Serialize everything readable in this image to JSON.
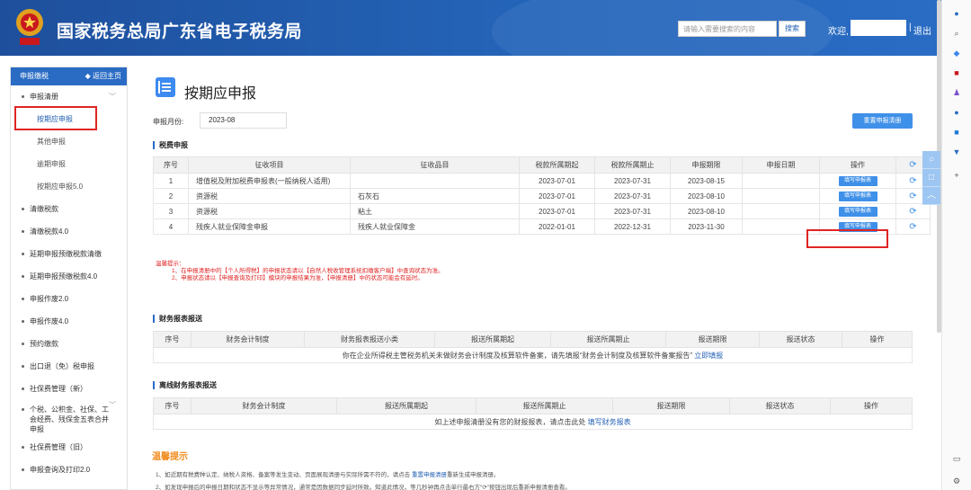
{
  "header": {
    "title": "国家税务总局广东省电子税务局",
    "search_placeholder": "请输入需要搜索的内容",
    "search_button": "搜索",
    "welcome": "欢迎,",
    "separator": "|",
    "logout": "退出",
    "emblem_text": "中国税务"
  },
  "sidebar": {
    "head": "申报缴税",
    "back": "◆ 返回主页",
    "items": [
      {
        "label": "申报清册",
        "type": "group"
      },
      {
        "label": "按期应申报",
        "type": "sub",
        "active": true
      },
      {
        "label": "其他申报",
        "type": "sub"
      },
      {
        "label": "逾期申报",
        "type": "sub"
      },
      {
        "label": "按期应申报5.0",
        "type": "sub"
      },
      {
        "label": "清缴税款",
        "type": "item"
      },
      {
        "label": "清缴税款4.0",
        "type": "item"
      },
      {
        "label": "延期申报预缴税款清缴",
        "type": "item"
      },
      {
        "label": "延期申报预缴税款4.0",
        "type": "item"
      },
      {
        "label": "申报作废2.0",
        "type": "item"
      },
      {
        "label": "申报作废4.0",
        "type": "item"
      },
      {
        "label": "预约缴款",
        "type": "item"
      },
      {
        "label": "出口退（免）税申报",
        "type": "item"
      },
      {
        "label": "社保费管理（新）",
        "type": "item"
      },
      {
        "label": "个税、公积金、社保、工会经费、残保金五表合并申报",
        "type": "multi"
      },
      {
        "label": "社保费管理（旧）",
        "type": "item"
      },
      {
        "label": "申报查询及打印2.0",
        "type": "item"
      }
    ]
  },
  "main": {
    "title": "按期应申报",
    "period_label": "申报月份:",
    "period_value": "2023-08",
    "reset_button": "重置申报清册",
    "tax_section": "税费申报",
    "tax_columns": [
      "序号",
      "征收项目",
      "征收品目",
      "税款所属期起",
      "税款所属期止",
      "申报期限",
      "申报日期",
      "操作"
    ],
    "tax_rows": [
      {
        "no": "1",
        "item": "增值税及附加税费申报表(一般纳税人适用)",
        "sub": "",
        "start": "2023-07-01",
        "end": "2023-07-31",
        "deadline": "2023-08-15",
        "date": "",
        "action": "填写申报表"
      },
      {
        "no": "2",
        "item": "资源税",
        "sub": "石灰石",
        "start": "2023-07-01",
        "end": "2023-07-31",
        "deadline": "2023-08-10",
        "date": "",
        "action": "填写申报表"
      },
      {
        "no": "3",
        "item": "资源税",
        "sub": "粘土",
        "start": "2023-07-01",
        "end": "2023-07-31",
        "deadline": "2023-08-10",
        "date": "",
        "action": "填写申报表"
      },
      {
        "no": "4",
        "item": "残疾人就业保障金申报",
        "sub": "残疾人就业保障金",
        "start": "2022-01-01",
        "end": "2022-12-31",
        "deadline": "2023-11-30",
        "date": "",
        "action": "填写申报表"
      }
    ],
    "warn_title": "温馨提示：",
    "warn_lines": [
      "1、在申报清册中的【个人所得税】的申报状态请以【自然人税收管理系统扣缴客户端】中查询状态为准。",
      "2、申报状态请以【申报查询及打印】模块的申报结果为准，【申报清册】中的状态可能会有延时。"
    ],
    "fin_section": "财务报表报送",
    "fin_columns": [
      "序号",
      "财务会计制度",
      "财务报表报送小类",
      "报送所属期起",
      "报送所属期止",
      "报送期限",
      "报送状态",
      "操作"
    ],
    "fin_note": "你在企业所得税主管税务机关未做财务会计制度及核算软件备案，请先填报“财务会计制度及核算软件备案报告”",
    "fin_link": "立即填报",
    "offline_section": "离线财务报表报送",
    "offline_columns": [
      "序号",
      "财务会计制度",
      "报送所属期起",
      "报送所属期止",
      "报送期限",
      "报送状态",
      "操作"
    ],
    "offline_note": "如上述申报清册没有您的财报报表，请点击此处",
    "offline_link": "填写财务报表",
    "tips_title": "温馨提示",
    "tip1_a": "1、如近期有税费种认定、纳税人资格、备案等发生变动、页面展现清册与实际所需不符的，请点击",
    "tip1_link": "重置申报清册",
    "tip1_b": "重新生成申报清册。",
    "tip2": "2、如发现申报后的申报日期和状态不显示等异常情况，通常是因数据同步延时所致。知道此情况，等几秒钟再点击单行最右方“⟳”按钮出现后重新申报清册查看。"
  },
  "icons": {
    "refresh": "⟳",
    "caret": "﹀",
    "accent": "#2a6cc4",
    "button": "#3f90e8",
    "warn": "#e02424"
  }
}
